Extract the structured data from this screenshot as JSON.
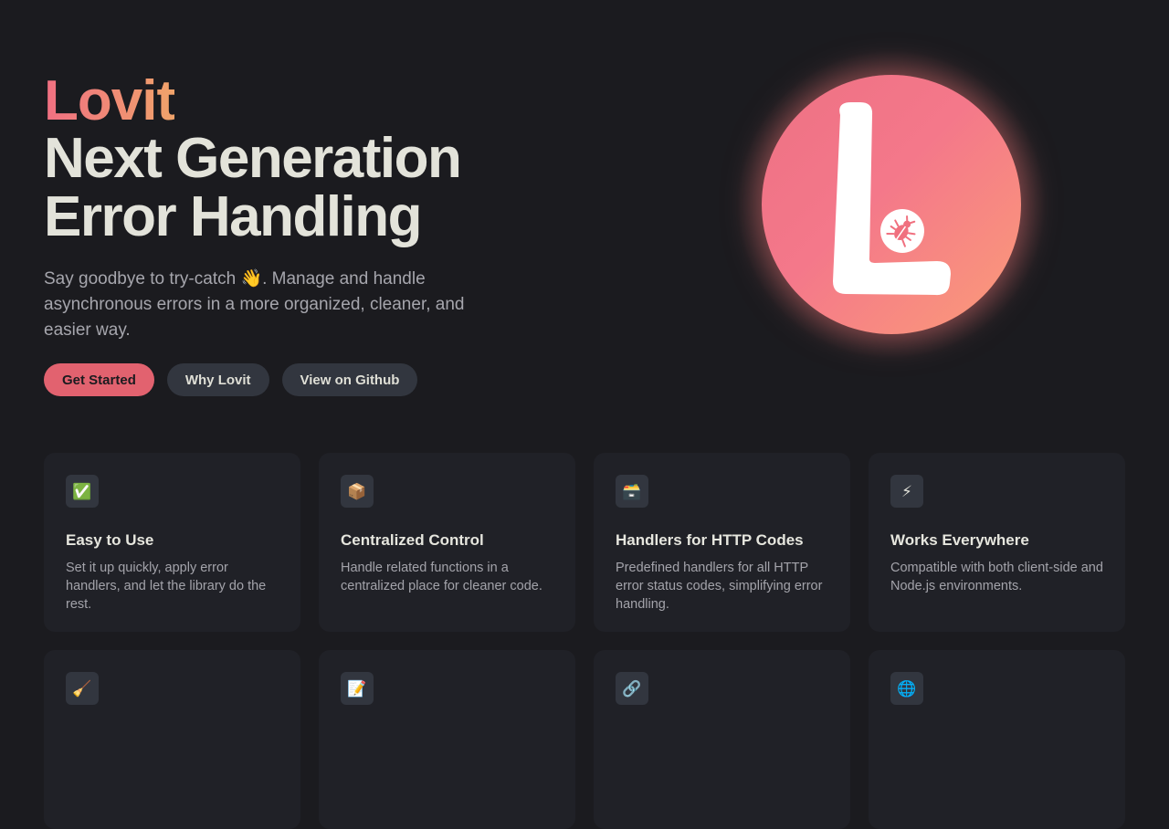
{
  "hero": {
    "brand": "Lovit",
    "headline_line1": "Next Generation",
    "headline_line2": "Error Handling",
    "tagline": "Say goodbye to try-catch 👋. Manage and handle asynchronous errors in a more organized, cleaner, and easier way.",
    "actions": {
      "primary_label": "Get Started",
      "why_label": "Why Lovit",
      "github_label": "View on Github"
    },
    "logo_icon": "bug-icon"
  },
  "colors": {
    "brand_pink": "#e2626f",
    "brand_orange": "#fb9c78",
    "background": "#1b1b1f",
    "card": "#202127"
  },
  "features": [
    {
      "icon": "✅",
      "icon_name": "check-mark-icon",
      "title": "Easy to Use",
      "desc": "Set it up quickly, apply error handlers, and let the library do the rest."
    },
    {
      "icon": "📦",
      "icon_name": "package-icon",
      "title": "Centralized Control",
      "desc": "Handle related functions in a centralized place for cleaner code."
    },
    {
      "icon": "🗃️",
      "icon_name": "card-file-box-icon",
      "title": "Handlers for HTTP Codes",
      "desc": "Predefined handlers for all HTTP error status codes, simplifying error handling."
    },
    {
      "icon": "⚡",
      "icon_name": "lightning-icon",
      "title": "Works Everywhere",
      "desc": "Compatible with both client-side and Node.js environments."
    },
    {
      "icon": "🧹",
      "icon_name": "broom-icon",
      "title": "",
      "desc": ""
    },
    {
      "icon": "📝",
      "icon_name": "memo-icon",
      "title": "",
      "desc": ""
    },
    {
      "icon": "🔗",
      "icon_name": "link-icon",
      "title": "",
      "desc": ""
    },
    {
      "icon": "🌐",
      "icon_name": "globe-icon",
      "title": "",
      "desc": ""
    }
  ]
}
